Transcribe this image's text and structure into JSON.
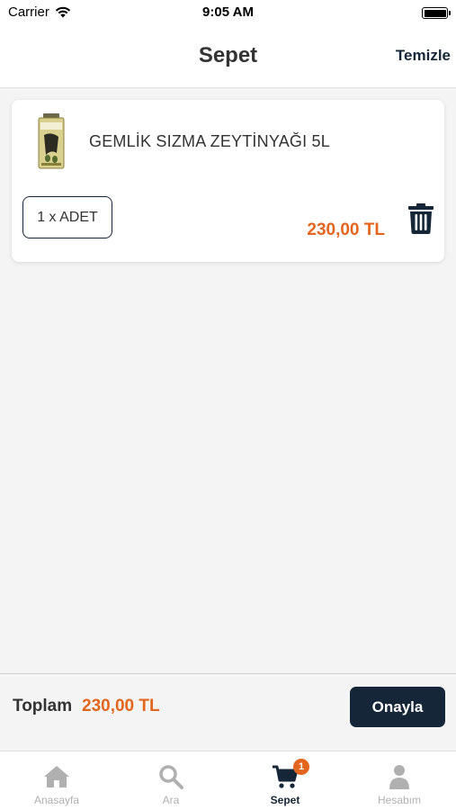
{
  "status_bar": {
    "carrier": "Carrier",
    "time": "9:05 AM",
    "icons": [
      "wifi-icon",
      "battery-icon"
    ]
  },
  "header": {
    "title": "Sepet",
    "clear_label": "Temizle"
  },
  "cart": {
    "items": [
      {
        "name": "GEMLİK SIZMA ZEYTİNYAĞI 5L",
        "quantity_label": "1 x ADET",
        "price": "230,00 TL",
        "image_icon": "olive-oil-product-image",
        "delete_icon": "trash-icon"
      }
    ]
  },
  "footer": {
    "total_label": "Toplam",
    "total_value": "230,00 TL",
    "confirm_label": "Onayla"
  },
  "tabs": [
    {
      "label": "Anasayfa",
      "icon": "home-icon",
      "active": false
    },
    {
      "label": "Ara",
      "icon": "search-icon",
      "active": false
    },
    {
      "label": "Sepet",
      "icon": "cart-icon",
      "active": true,
      "badge": "1"
    },
    {
      "label": "Hesabım",
      "icon": "user-icon",
      "active": false
    }
  ],
  "colors": {
    "accent": "#e4661e",
    "primary": "#142638",
    "background": "#f4f4f4",
    "inactive_tab": "#b0b0b0"
  }
}
